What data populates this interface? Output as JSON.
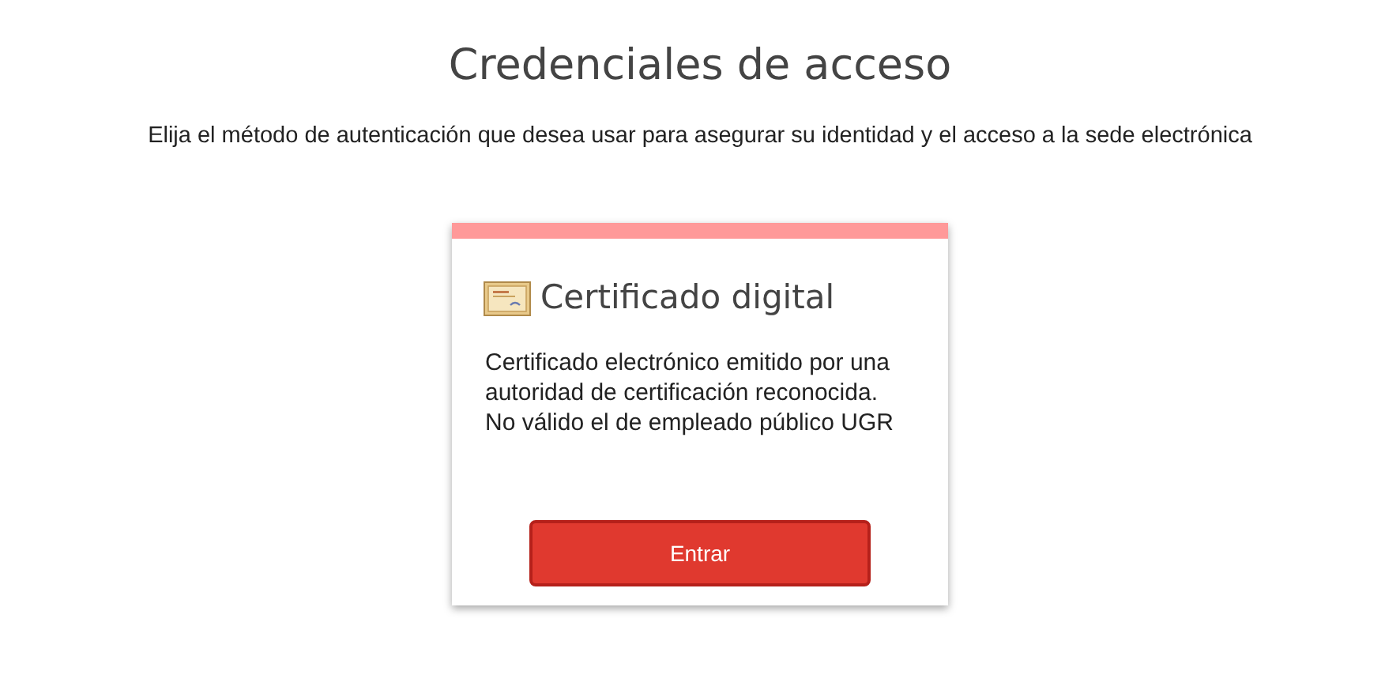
{
  "title": "Credenciales de acceso",
  "subtitle": "Elija el método de autenticación que desea usar para asegurar su identidad y el acceso a la sede electrónica",
  "cards": [
    {
      "title": "Certificado digital",
      "description_lines": [
        "Certificado electrónico emitido por una",
        "autoridad de certificación reconocida.",
        "No válido el de empleado público UGR"
      ],
      "button": "Entrar",
      "color": "#ff9999"
    }
  ]
}
